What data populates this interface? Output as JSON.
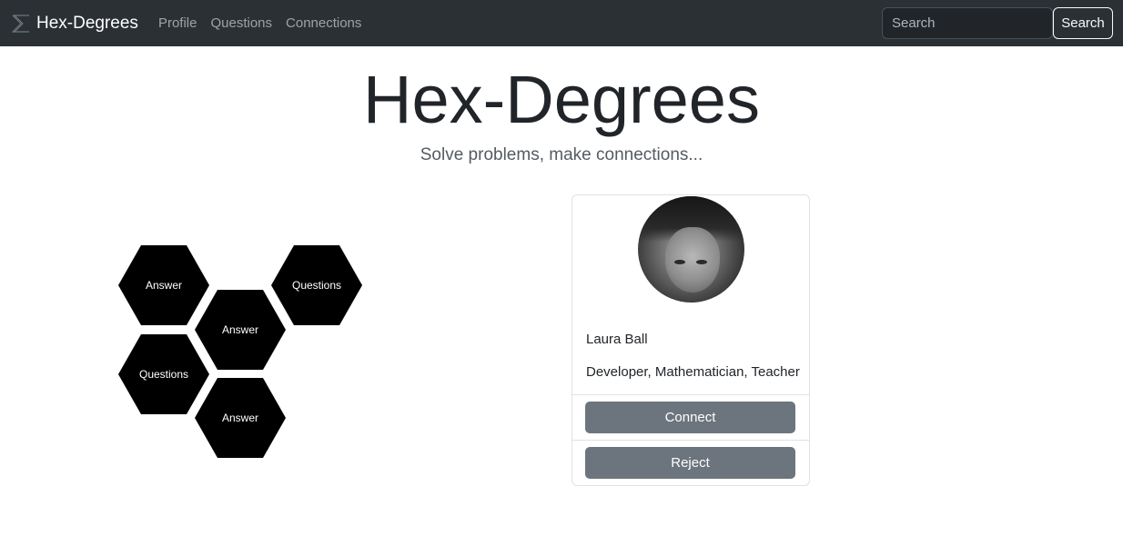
{
  "navbar": {
    "brand": "Hex-Degrees",
    "brand_icon": "sigma-icon",
    "links": [
      "Profile",
      "Questions",
      "Connections"
    ],
    "search_placeholder": "Search",
    "search_button": "Search"
  },
  "hero": {
    "title": "Hex-Degrees",
    "subtitle": "Solve problems, make connections..."
  },
  "hexes": [
    "Answer",
    "Questions",
    "Answer",
    "Questions",
    "Answer"
  ],
  "profile": {
    "name": "Laura Ball",
    "roles": "Developer, Mathematician, Teacher",
    "connect_label": "Connect",
    "reject_label": "Reject"
  },
  "colors": {
    "navbar_bg": "#2b3035",
    "button_bg": "#6c757d",
    "hex_bg": "#000000"
  }
}
